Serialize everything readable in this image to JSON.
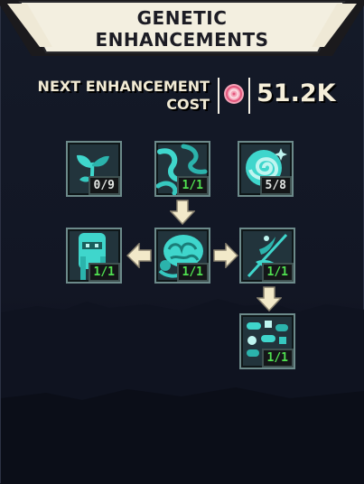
{
  "header": {
    "title_line1": "GENETIC",
    "title_line2": "ENHANCEMENTS"
  },
  "cost": {
    "label_line1": "NEXT ENHANCEMENT",
    "label_line2": "COST",
    "currency_icon": "pink-dna-spiral-icon",
    "value": "51.2K"
  },
  "nodes": [
    {
      "name": "sprout",
      "icon": "sprout-icon",
      "level": "0/9",
      "maxed": false
    },
    {
      "name": "tentacles",
      "icon": "tentacles-icon",
      "level": "1/1",
      "maxed": true
    },
    {
      "name": "spiral-candy",
      "icon": "spiral-swirl-icon",
      "level": "5/8",
      "maxed": false
    },
    {
      "name": "humanoid",
      "icon": "humanoid-head-icon",
      "level": "1/1",
      "maxed": true
    },
    {
      "name": "brain",
      "icon": "brain-mass-icon",
      "level": "1/1",
      "maxed": true
    },
    {
      "name": "needle",
      "icon": "syringe-needle-icon",
      "level": "1/1",
      "maxed": true
    },
    {
      "name": "pills",
      "icon": "pills-icon",
      "level": "1/1",
      "maxed": true
    }
  ],
  "colors": {
    "background": "#121724",
    "accent_teal": "#3fd6cc",
    "badge_full": "#50e050",
    "badge_partial": "#e3e6e3",
    "arrow": "#f2e9c9"
  }
}
